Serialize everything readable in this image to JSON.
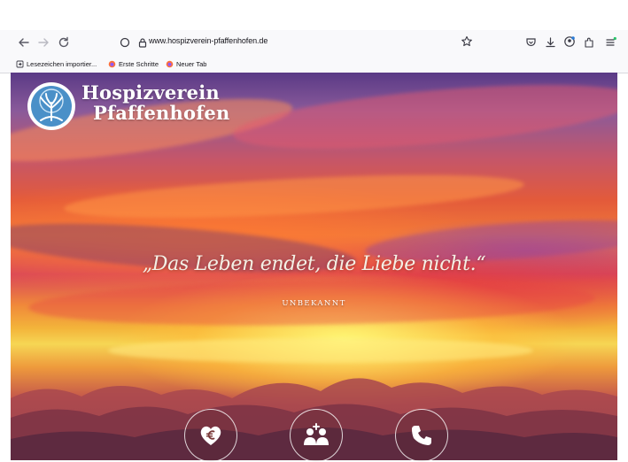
{
  "browser": {
    "url": "www.hospizverein-pfaffenhofen.de",
    "bookmarks": [
      "Lesezeichen importier...",
      "Erste Schritte",
      "Neuer Tab"
    ]
  },
  "site": {
    "brand_line1": "Hospizverein",
    "brand_line2": "Pfaffenhofen",
    "quote": "„Das Leben endet, die Liebe nicht.“",
    "author": "UNBEKANNT"
  },
  "icons": {
    "donate": "heart-euro-icon",
    "members": "group-add-icon",
    "contact": "phone-icon"
  },
  "colors": {
    "brand_blue": "#4a90c8",
    "text_white": "#ffffff"
  }
}
